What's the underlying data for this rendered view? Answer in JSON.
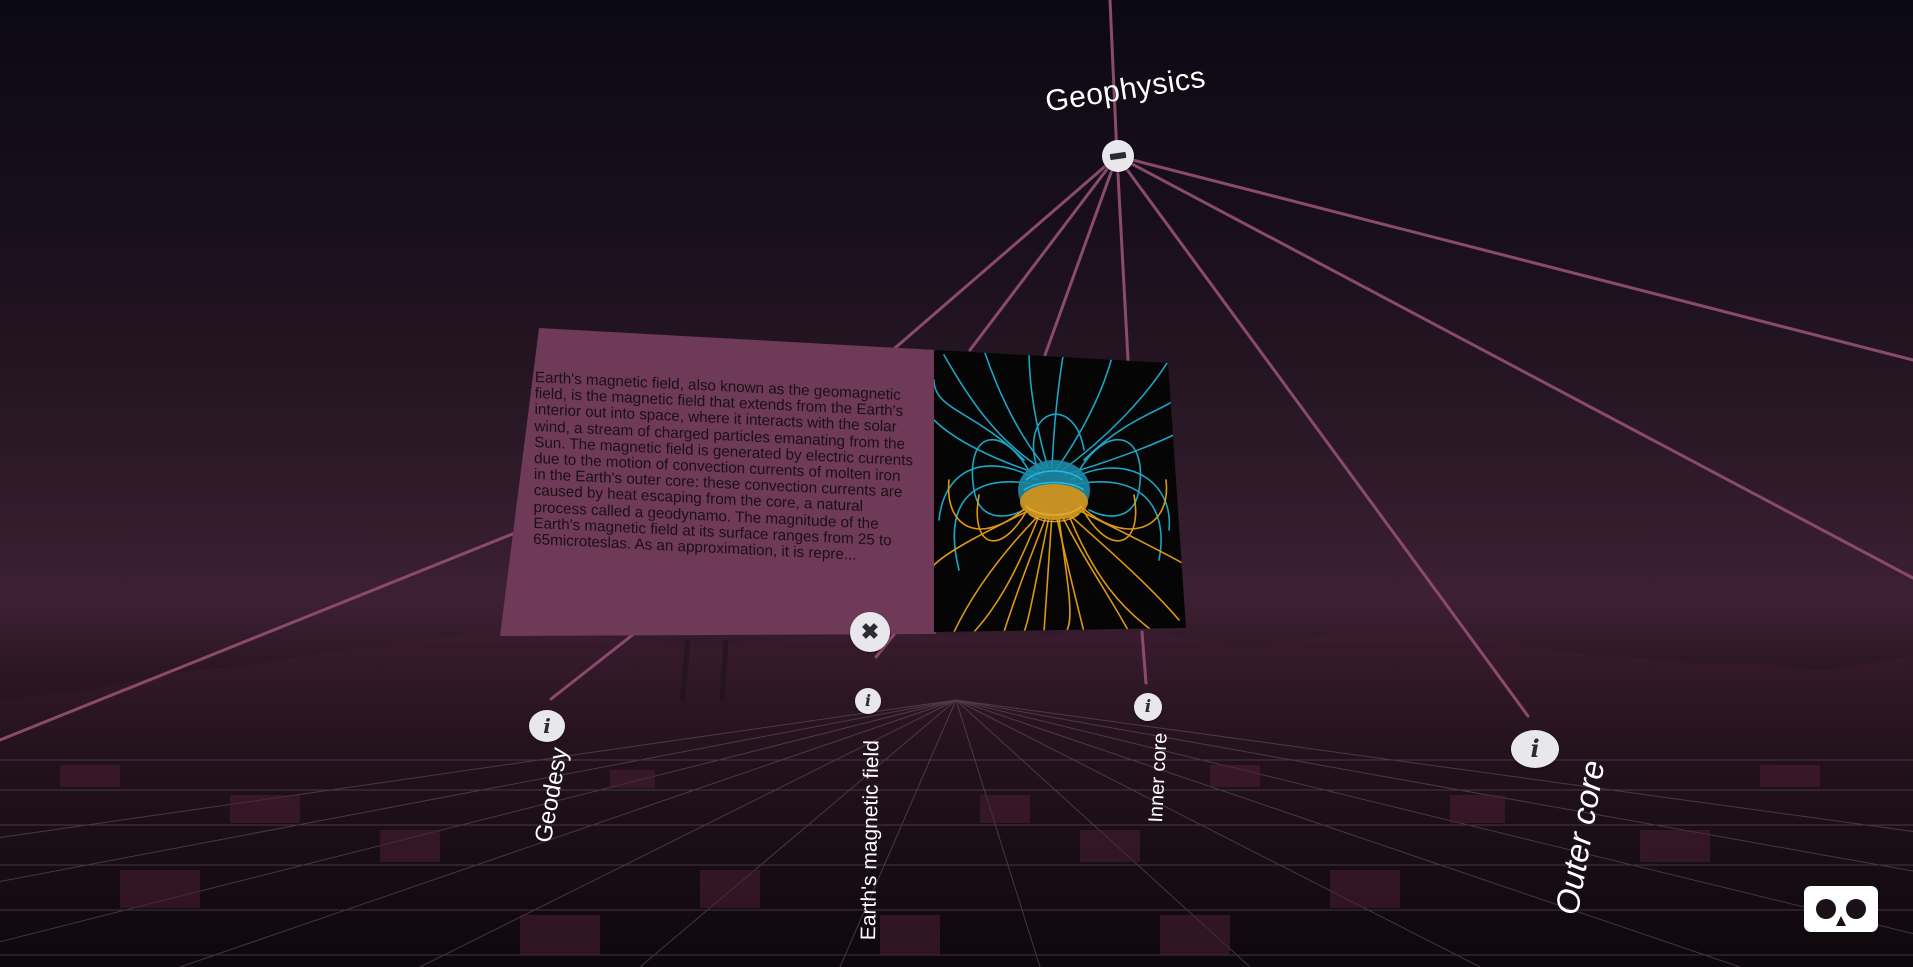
{
  "graph": {
    "root": {
      "label": "Geophysics",
      "collapse_icon": "minus-icon"
    },
    "nodes": [
      {
        "label": "Geodesy",
        "icon": "info-icon"
      },
      {
        "label": "Earth's magnetic field",
        "icon": "info-icon"
      },
      {
        "label": "Inner core",
        "icon": "info-icon"
      },
      {
        "label": "Outer core",
        "icon": "info-icon"
      }
    ]
  },
  "info_card": {
    "text": "Earth's magnetic field, also known as the geomagnetic field, is the magnetic field that extends from the Earth's interior out into space, where it interacts with the solar wind, a stream of charged particles emanating from the Sun. The magnetic field is generated by electric currents due to the motion of convection currents of molten iron in the Earth's outer core: these convection currents are caused by heat escaping from the core, a natural process called a geodynamo. The magnitude of the Earth's magnetic field at its surface ranges from 25 to 65microteslas. As an approximation, it is repre...",
    "image": "magnetic-field-lines-image",
    "close_icon": "close-x-icon"
  },
  "vr_button": {
    "icon": "cardboard-vr-icon"
  },
  "colors": {
    "link": "#8a4a6c",
    "card_background": "#6f3a58",
    "field_cyan": "#1fb7d9",
    "field_orange": "#e8a114"
  }
}
